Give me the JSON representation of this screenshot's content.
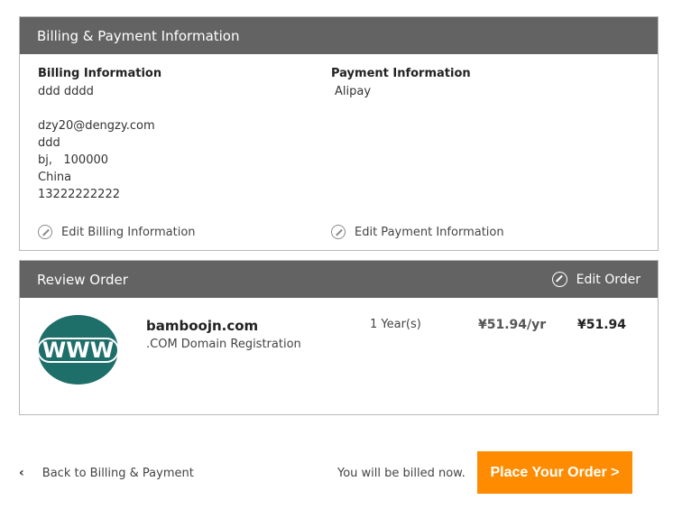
{
  "billing_panel": {
    "header": "Billing & Payment Information",
    "billing": {
      "title": "Billing Information",
      "name": "ddd dddd",
      "email": "dzy20@dengzy.com",
      "address": "ddd",
      "city_zip": "bj,   100000",
      "country": "China",
      "phone": "13222222222",
      "edit_label": "Edit Billing Information"
    },
    "payment": {
      "title": "Payment Information",
      "method": "Alipay",
      "edit_label": "Edit Payment Information"
    }
  },
  "review_panel": {
    "header": "Review Order",
    "edit_label": "Edit Order",
    "item": {
      "logo_text": "WWW",
      "domain": "bamboojn.com",
      "description": ".COM Domain Registration",
      "term": "1 Year(s)",
      "unit_price": "¥51.94/yr",
      "total": "¥51.94"
    }
  },
  "footer": {
    "back_label": "Back to Billing & Payment",
    "back_icon": "chevron-left-icon",
    "billed_note": "You will be billed now.",
    "place_order_label": "Place Your Order >"
  },
  "colors": {
    "header_bg": "#636363",
    "accent_orange": "#ff8c00",
    "logo_teal": "#1e6e6a"
  }
}
